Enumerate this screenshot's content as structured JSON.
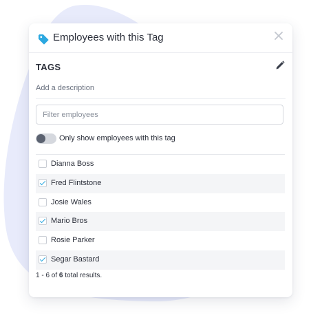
{
  "header": {
    "title": "Employees with this Tag",
    "icon": "tag-icon",
    "icon_color": "#2ba8e0",
    "close_icon": "close-icon"
  },
  "tag": {
    "name": "TAGS",
    "description_placeholder": "Add a description",
    "edit_icon": "pencil-icon"
  },
  "filter": {
    "placeholder": "Filter employees",
    "value": ""
  },
  "toggle": {
    "label": "Only show employees with this tag",
    "on": false
  },
  "employees": [
    {
      "name": "Dianna Boss",
      "checked": false
    },
    {
      "name": "Fred Flintstone",
      "checked": true
    },
    {
      "name": "Josie Wales",
      "checked": false
    },
    {
      "name": "Mario Bros",
      "checked": true
    },
    {
      "name": "Rosie Parker",
      "checked": false
    },
    {
      "name": "Segar Bastard",
      "checked": true
    }
  ],
  "results": {
    "prefix": "1 - 6 of",
    "total": "6",
    "suffix": "total results."
  },
  "colors": {
    "accent": "#2ba8e0",
    "blob": "#e8ebfb"
  }
}
